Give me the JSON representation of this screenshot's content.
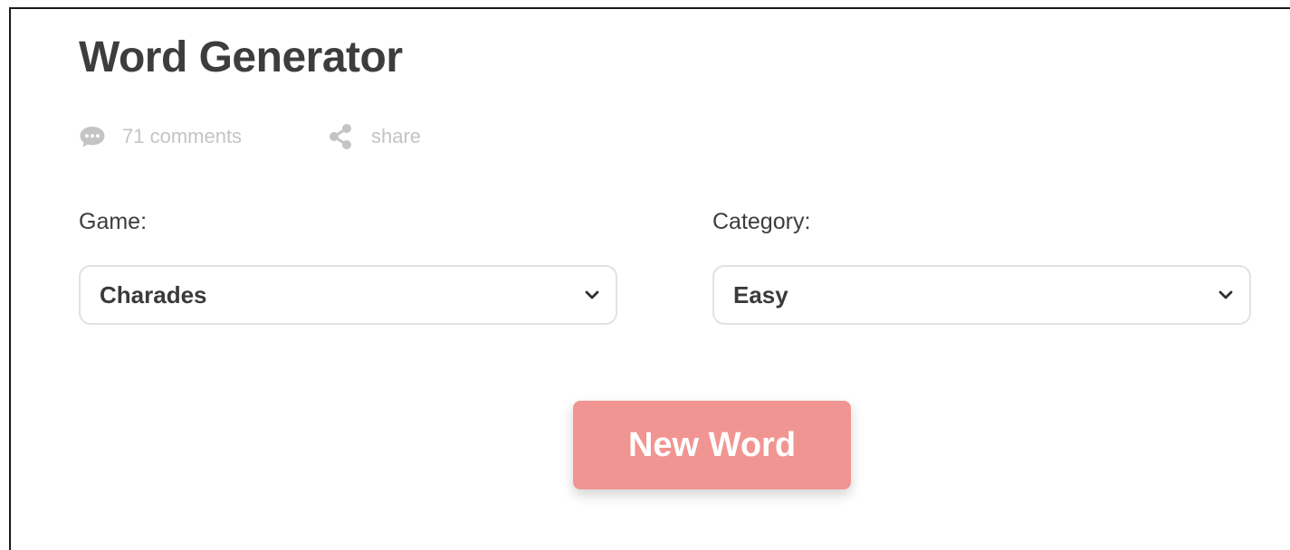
{
  "page": {
    "title": "Word Generator"
  },
  "meta": {
    "comments_label": "71 comments",
    "comments_icon": "speech-bubble-icon",
    "share_label": "share",
    "share_icon": "share-nodes-icon",
    "color": "#c4c4c4"
  },
  "form": {
    "game_label": "Game:",
    "game_value": "Charades",
    "category_label": "Category:",
    "category_value": "Easy",
    "dropdown_icon": "chevron-down-icon"
  },
  "actions": {
    "new_word_label": "New Word",
    "new_word_color": "#f19592"
  }
}
